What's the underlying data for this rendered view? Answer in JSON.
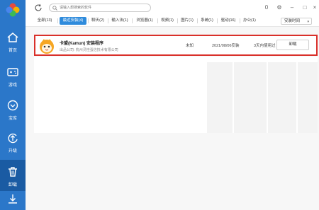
{
  "sidebar": {
    "items": [
      {
        "label": "首页",
        "icon": "home-icon"
      },
      {
        "label": "游戏",
        "icon": "gamepad-icon"
      },
      {
        "label": "宝库",
        "icon": "treasure-icon"
      },
      {
        "label": "升级",
        "icon": "upgrade-icon"
      },
      {
        "label": "卸载",
        "icon": "trash-icon"
      }
    ],
    "active_index": 4,
    "bottom_icon": "download-icon"
  },
  "topbar": {
    "search_placeholder": "请输入想搜索的软件",
    "badge_count": "0"
  },
  "tabs": [
    {
      "label": "全部(13)"
    },
    {
      "label": "最近安装(4)"
    },
    {
      "label": "聊天(2)"
    },
    {
      "label": "输入法(1)"
    },
    {
      "label": "浏览器(1)"
    },
    {
      "label": "视频(1)"
    },
    {
      "label": "图片(1)"
    },
    {
      "label": "系统(1)"
    },
    {
      "label": "驱动(16)"
    },
    {
      "label": "办公(1)"
    }
  ],
  "active_tab": 1,
  "sort": {
    "label": "安装时间"
  },
  "apps": [
    {
      "name": "卡盟(Kamun) 安装程序",
      "desc": "出品公司: 杭州灵桂蛋信技术有限公司",
      "size": "未知",
      "date": "2021/08/06安装",
      "usage": "3天内使用过",
      "action": "卸载"
    }
  ],
  "colors": {
    "sidebar": "#2b77c9",
    "sidebar_active": "#1a5ba3",
    "tab_active": "#2e8bdc",
    "highlight_border": "#d9302a"
  }
}
